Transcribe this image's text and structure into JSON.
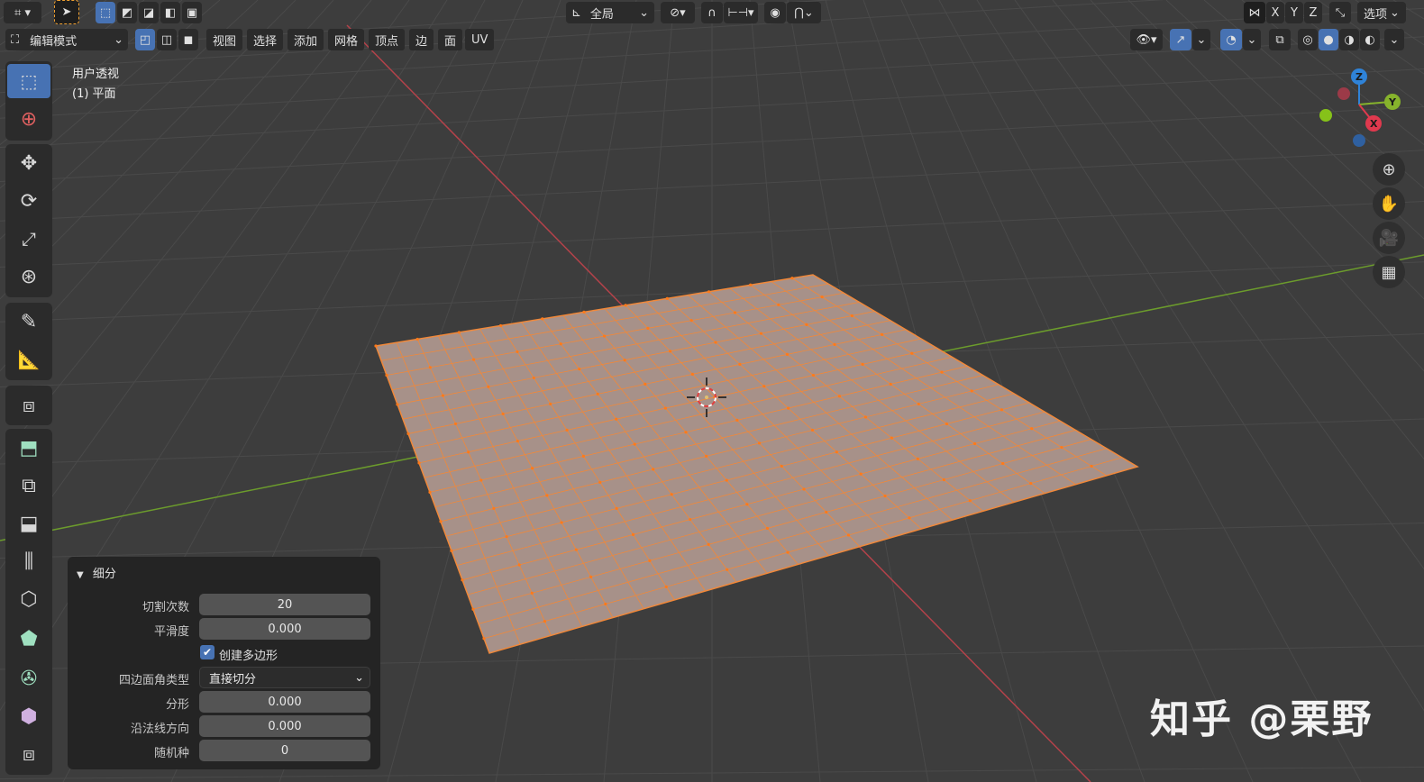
{
  "topbar": {
    "transform_orientation": "全局",
    "axis_x": "X",
    "axis_y": "Y",
    "axis_z": "Z",
    "options": "选项"
  },
  "header": {
    "mode": "编辑模式",
    "menus": [
      "视图",
      "选择",
      "添加",
      "网格",
      "顶点",
      "边",
      "面",
      "UV"
    ]
  },
  "viewport": {
    "view_name": "用户透视",
    "object_name": "(1) 平面"
  },
  "gizmo": {
    "x": "X",
    "y": "Y",
    "z": "Z"
  },
  "redo_panel": {
    "title": "细分",
    "number_of_cuts_label": "切割次数",
    "number_of_cuts": "20",
    "smoothness_label": "平滑度",
    "smoothness": "0.000",
    "create_ngons_label": "创建多边形",
    "create_ngons": true,
    "quad_corner_type_label": "四边面角类型",
    "quad_corner_type": "直接切分",
    "fractal_label": "分形",
    "fractal": "0.000",
    "along_normal_label": "沿法线方向",
    "along_normal": "0.000",
    "random_seed_label": "随机种",
    "random_seed": "0"
  },
  "watermark": "知乎 @栗野",
  "colors": {
    "viewport_bg": "#3d3d3d",
    "grid": "#4a4a4a",
    "axis_x": "#b4424a",
    "axis_y": "#6c9c2c",
    "mesh_face": "#a79189",
    "mesh_edge": "#f0883a",
    "accent": "#4772b3"
  }
}
